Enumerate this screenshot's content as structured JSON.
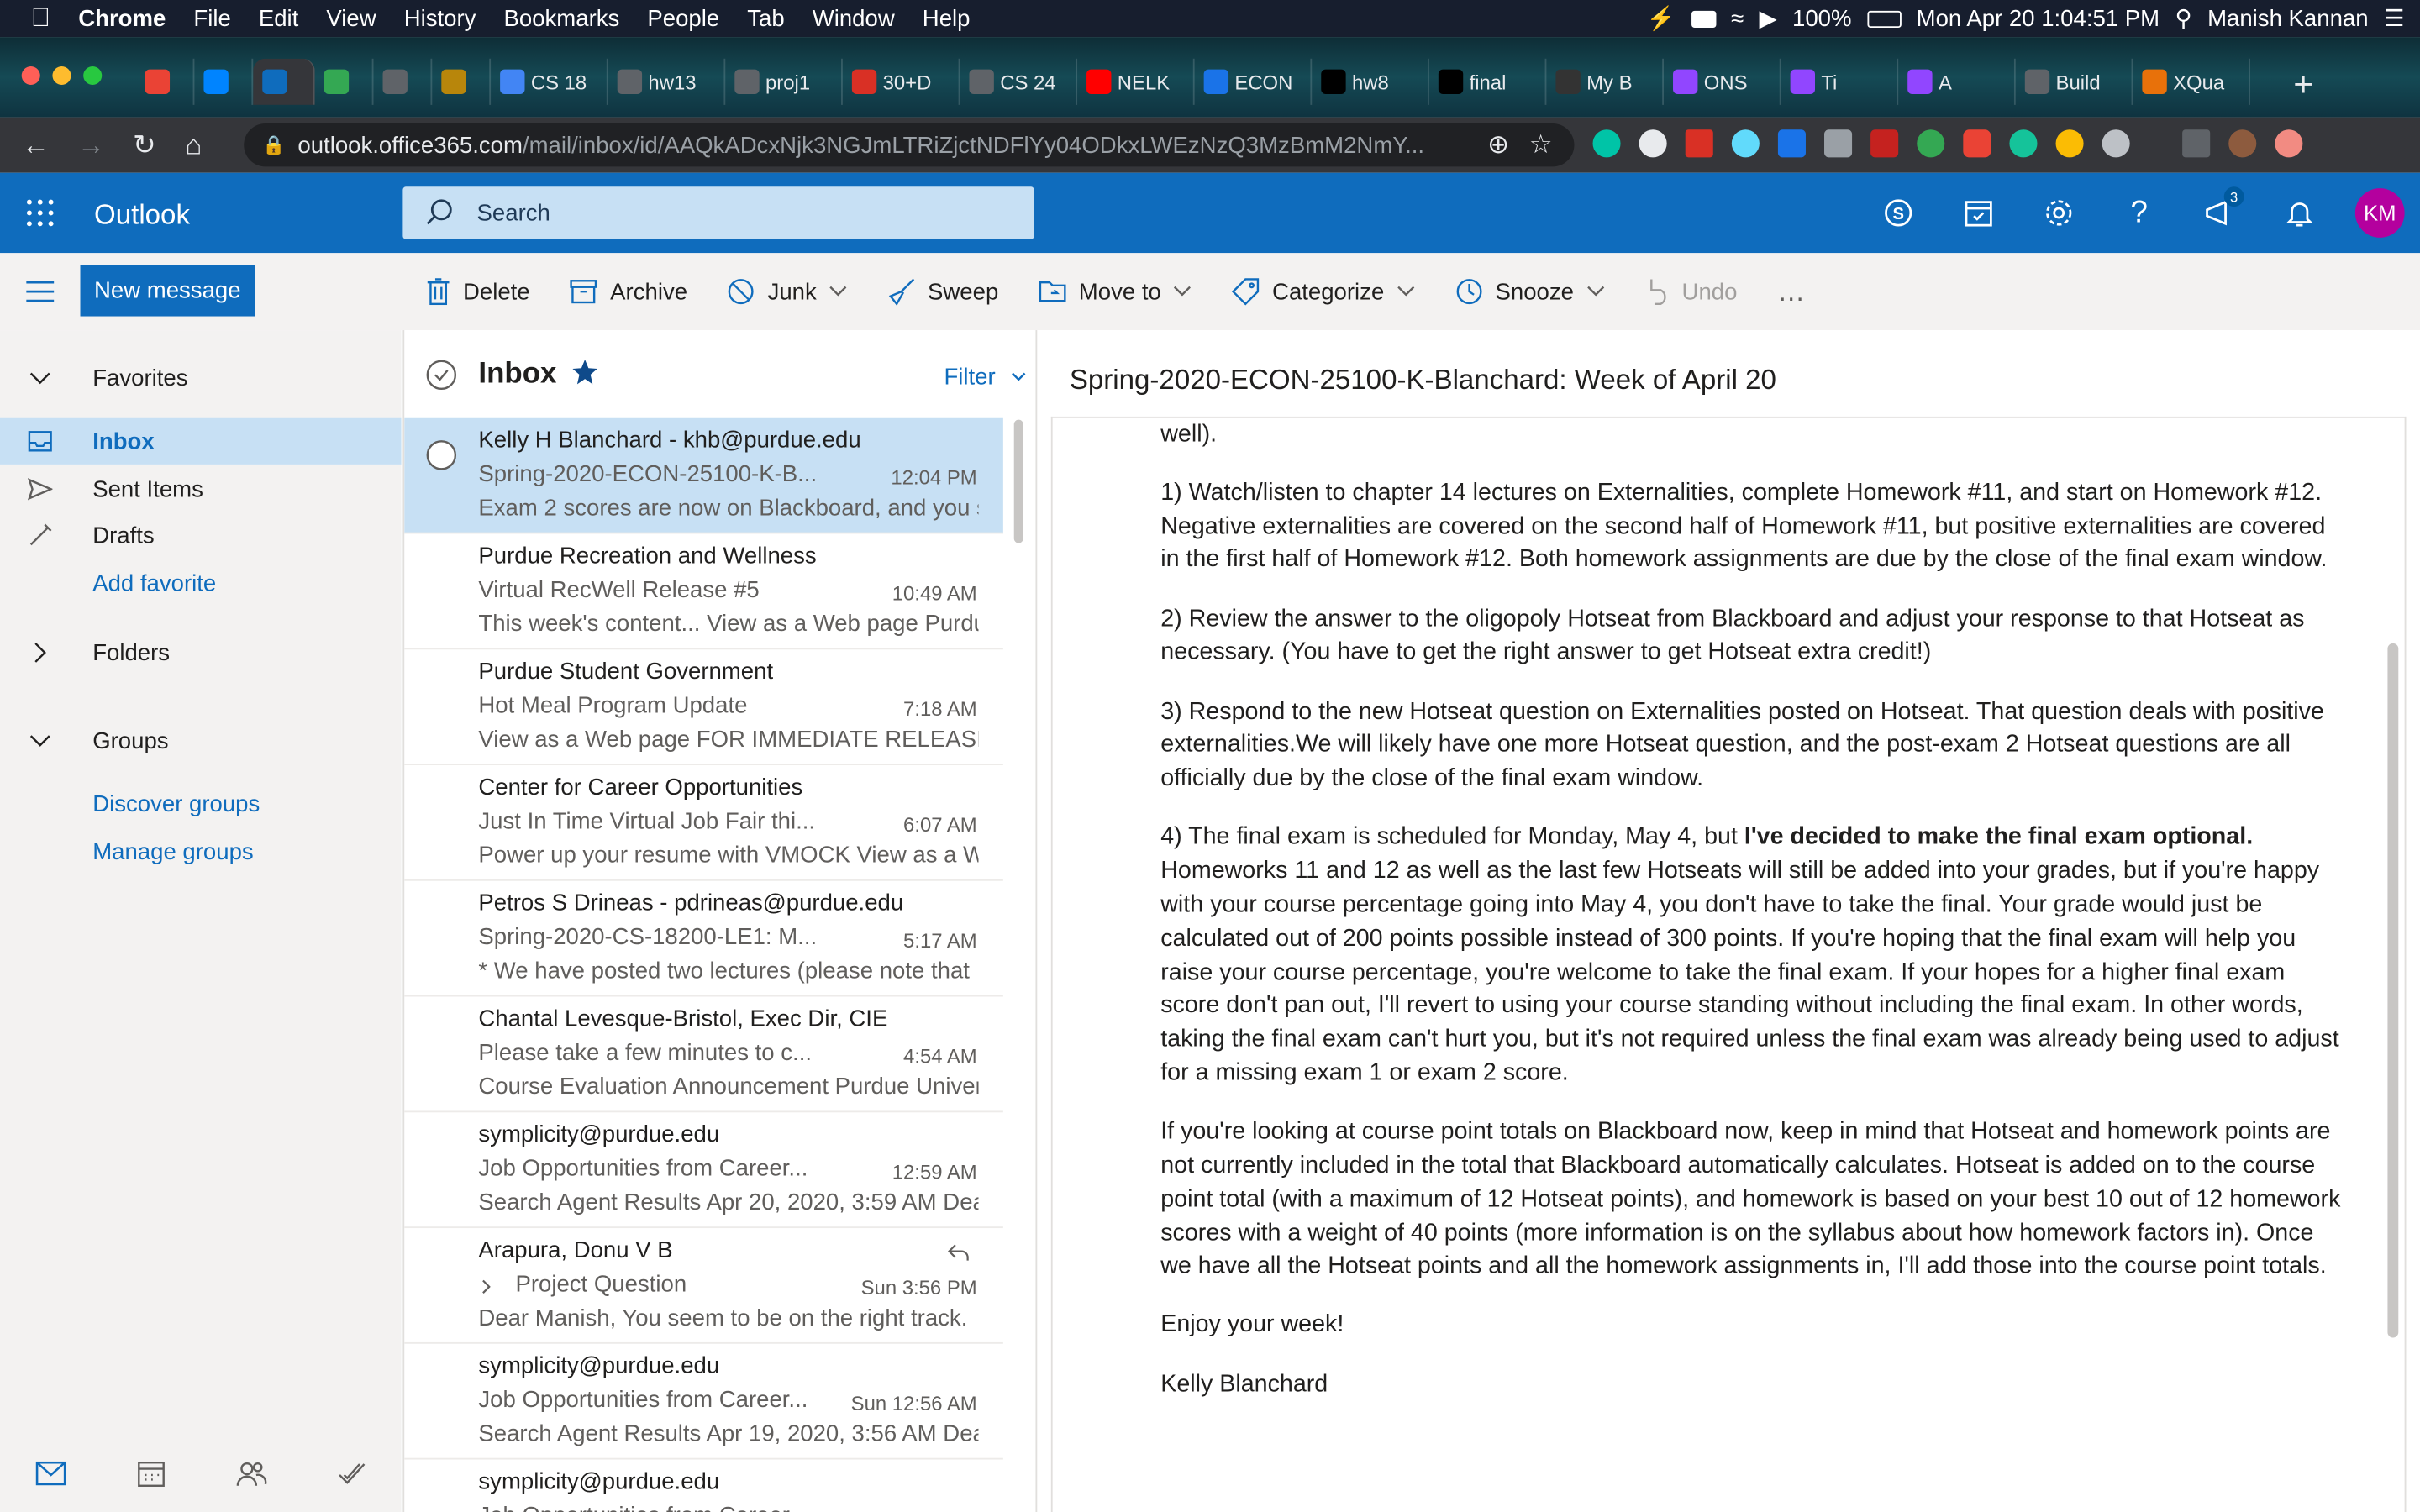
{
  "macos": {
    "app": "Chrome",
    "menus": [
      "File",
      "Edit",
      "View",
      "History",
      "Bookmarks",
      "People",
      "Tab",
      "Window",
      "Help"
    ],
    "battery": "100%",
    "clock": "Mon Apr 20  1:04:51 PM",
    "user": "Manish Kannan"
  },
  "browser": {
    "tabs": [
      {
        "label": "",
        "color": "#ea4335"
      },
      {
        "label": "",
        "color": "#0084ff"
      },
      {
        "label": "",
        "color": "#0f6cbd"
      },
      {
        "label": "",
        "color": "#34a853"
      },
      {
        "label": "",
        "color": "#5f6368"
      },
      {
        "label": "",
        "color": "#b8860b"
      },
      {
        "label": "CS 18",
        "color": "#4285f4"
      },
      {
        "label": "hw13",
        "color": "#5f6368"
      },
      {
        "label": "proj1",
        "color": "#5f6368"
      },
      {
        "label": "30+D",
        "color": "#d93025"
      },
      {
        "label": "CS 24",
        "color": "#5f6368"
      },
      {
        "label": "NELK",
        "color": "#ff0000"
      },
      {
        "label": "ECON",
        "color": "#1a73e8"
      },
      {
        "label": "hw8",
        "color": "#000000"
      },
      {
        "label": "final",
        "color": "#000000"
      },
      {
        "label": "My B",
        "color": "#333333"
      },
      {
        "label": "ONS",
        "color": "#9146ff"
      },
      {
        "label": "Ti",
        "color": "#9146ff"
      },
      {
        "label": "A",
        "color": "#9146ff"
      },
      {
        "label": "Build",
        "color": "#5f6368"
      },
      {
        "label": "XQua",
        "color": "#e8710a"
      }
    ],
    "url_host": "outlook.office365.com",
    "url_path": "/mail/inbox/id/AAQkADcxNjk3NGJmLTRiZjctNDFlYy04ODkxLWEzNzQ3MzBmM2NmY..."
  },
  "outlook": {
    "brand": "Outlook",
    "search_placeholder": "Search",
    "avatar_initials": "KM",
    "notification_count": "3"
  },
  "commands": {
    "new_message": "New message",
    "delete": "Delete",
    "archive": "Archive",
    "junk": "Junk",
    "sweep": "Sweep",
    "move_to": "Move to",
    "categorize": "Categorize",
    "snooze": "Snooze",
    "undo": "Undo"
  },
  "nav": {
    "favorites": "Favorites",
    "inbox": "Inbox",
    "sent": "Sent Items",
    "drafts": "Drafts",
    "add_favorite": "Add favorite",
    "folders": "Folders",
    "groups": "Groups",
    "discover_groups": "Discover groups",
    "manage_groups": "Manage groups"
  },
  "list": {
    "title": "Inbox",
    "filter": "Filter",
    "messages": [
      {
        "sender": "Kelly H Blanchard - khb@purdue.edu",
        "subject": "Spring-2020-ECON-25100-K-B...",
        "time": "12:04 PM",
        "preview": "Exam 2 scores are now on Blackboard, and you s"
      },
      {
        "sender": "Purdue Recreation and Wellness",
        "subject": "Virtual RecWell Release #5",
        "time": "10:49 AM",
        "preview": "This week's content... View as a Web page Purdu"
      },
      {
        "sender": "Purdue Student Government",
        "subject": "Hot Meal Program Update",
        "time": "7:18 AM",
        "preview": "View as a Web page FOR IMMEDIATE RELEASE B"
      },
      {
        "sender": "Center for Career Opportunities",
        "subject": "Just In Time Virtual Job Fair thi...",
        "time": "6:07 AM",
        "preview": "Power up your resume with VMOCK View as a W"
      },
      {
        "sender": "Petros S Drineas - pdrineas@purdue.edu",
        "subject": "Spring-2020-CS-18200-LE1: M...",
        "time": "5:17 AM",
        "preview": "* We have posted two lectures (please note that"
      },
      {
        "sender": "Chantal Levesque-Bristol, Exec Dir, CIE",
        "subject": "Please take a few minutes to c...",
        "time": "4:54 AM",
        "preview": "Course Evaluation Announcement Purdue Univer"
      },
      {
        "sender": "symplicity@purdue.edu",
        "subject": "Job Opportunities from Career...",
        "time": "12:59 AM",
        "preview": "Search Agent Results Apr 20, 2020, 3:59 AM Dea"
      },
      {
        "sender": "Arapura, Donu V B",
        "subject": "Project Question",
        "time": "Sun 3:56 PM",
        "preview": "Dear Manish, You seem to be on the right track."
      },
      {
        "sender": "symplicity@purdue.edu",
        "subject": "Job Opportunities from Career...",
        "time": "Sun 12:56 AM",
        "preview": "Search Agent Results Apr 19, 2020, 3:56 AM Dea"
      },
      {
        "sender": "symplicity@purdue.edu",
        "subject": "Job Opportunities from Career...",
        "time": "",
        "preview": ""
      }
    ]
  },
  "reading": {
    "title": "Spring-2020-ECON-25100-K-Blanchard: Week of April 20",
    "p0": "well).",
    "p1": "1)  Watch/listen to chapter 14 lectures on Externalities, complete Homework #11, and start on Homework #12.  Negative externalities are covered on the second half of Homework #11, but positive externalities are covered in the first half of Homework #12. Both homework assignments are due by the close of the final exam window.",
    "p2": "2) Review the answer to the oligopoly Hotseat from Blackboard and adjust your response to that Hotseat as necessary. (You have to get the right answer to get Hotseat extra credit!)",
    "p3": "3) Respond to the new Hotseat question on Externalities posted on Hotseat. That question deals with positive externalities.We will likely have one more Hotseat question, and the post-exam 2 Hotseat questions are all officially due by the close of the final exam window.",
    "p4a": "4) The final exam is scheduled for Monday, May 4, but ",
    "p4b": "I've decided to make the final exam optional.",
    "p4c": " Homeworks 11 and 12 as well as the last few Hotseats will still be added into your grades, but if you're happy with your course percentage going into May 4, you don't have to take the final. Your grade would just be calculated out of 200 points possible instead of 300 points. If you're hoping that the final exam will help you raise your course percentage, you're welcome to take the final exam. If your hopes for a higher final exam score don't pan out, I'll revert to using your course standing without including the final exam. In other words, taking the final exam can't hurt you, but it's not required unless the final exam was already being used to adjust for a missing exam 1 or exam 2 score.",
    "p5": "If you're looking at course point totals on Blackboard now, keep in mind that Hotseat and homework points are not currently included in the total that Blackboard automatically calculates. Hotseat is added on to the course point total (with a maximum of 12 Hotseat points), and homework is based on your best 10 out of 12 homework scores with a weight of 40 points (more information is on the syllabus about how homework factors in). Once we have all the Hotseat points and all the homework assignments in, I'll add those into the course point totals.",
    "p6": "Enjoy your week!",
    "p7": "Kelly Blanchard"
  }
}
